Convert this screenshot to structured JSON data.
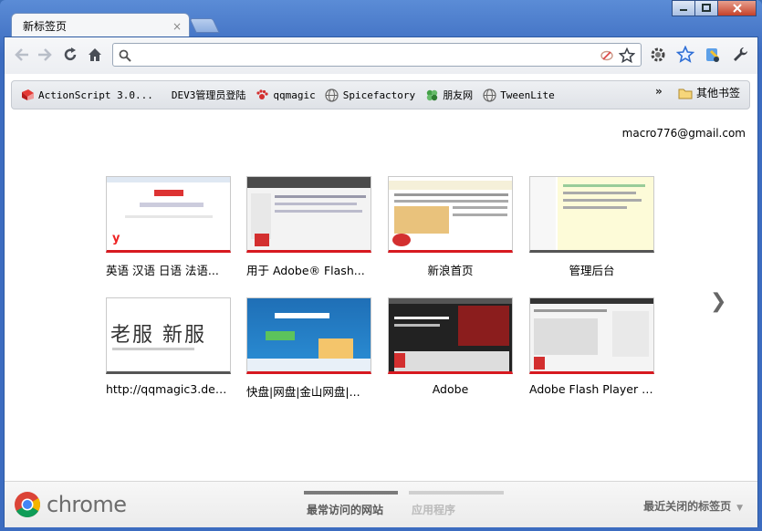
{
  "window": {
    "controls": [
      "minimize",
      "maximize",
      "close"
    ]
  },
  "tab": {
    "title": "新标签页",
    "close": "×"
  },
  "omnibox": {
    "value": "",
    "placeholder": ""
  },
  "bookmarks": {
    "items": [
      {
        "label": "ActionScript 3.0...",
        "icon": "actionscript-book-icon"
      },
      {
        "label": "DEV3管理员登陆",
        "icon": ""
      },
      {
        "label": "qqmagic",
        "icon": "paw-icon"
      },
      {
        "label": "Spicefactory",
        "icon": "globe-icon"
      },
      {
        "label": "朋友网",
        "icon": "clover-icon"
      },
      {
        "label": "TweenLite",
        "icon": "globe-icon"
      }
    ],
    "more": "»",
    "other": "其他书签"
  },
  "account": {
    "email": "macro776@gmail.com"
  },
  "most_visited": [
    {
      "caption": "英语 汉语 日语 法语...",
      "style": "red"
    },
    {
      "caption": "用于 Adobe® Flash...",
      "style": "red"
    },
    {
      "caption": "新浪首页",
      "style": "red"
    },
    {
      "caption": "管理后台",
      "style": "gray"
    },
    {
      "caption": "http://qqmagic3.dev...",
      "style": "gray"
    },
    {
      "caption": "快盘|网盘|金山网盘|...",
      "style": "red"
    },
    {
      "caption": "Adobe",
      "style": "red"
    },
    {
      "caption": "Adobe Flash Player -...",
      "style": "red"
    }
  ],
  "pager": {
    "next": "❯"
  },
  "footer": {
    "logo_text": "chrome",
    "tab_most_visited": "最常访问的网站",
    "tab_apps": "应用程序",
    "recently_closed": "最近关闭的标签页",
    "recently_closed_arrow": "▼"
  }
}
